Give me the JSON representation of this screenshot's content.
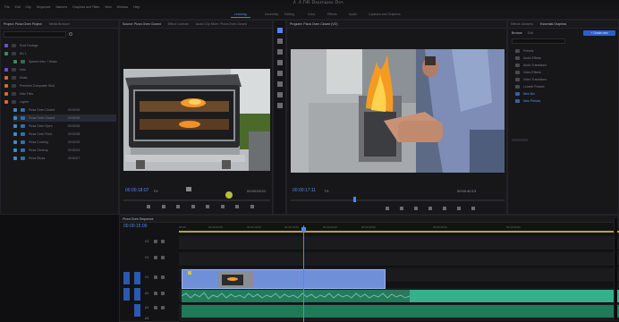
{
  "app": {
    "title": "人人DB Premiere Pro",
    "menu": [
      "File",
      "Edit",
      "Clip",
      "Sequence",
      "Markers",
      "Graphics and Titles",
      "View",
      "Window",
      "Help"
    ],
    "workspaces": [
      "Learning",
      "Assembly",
      "Editing",
      "Color",
      "Effects",
      "Audio",
      "Captions and Graphics"
    ],
    "active_workspace": "Learning"
  },
  "project_panel": {
    "tabs": [
      "Project: Pizza Oven Project",
      "Media Browser"
    ],
    "search_placeholder": "",
    "items": [
      {
        "name": "Root Footage",
        "color": "#6a4fd6"
      },
      {
        "name": "Bin 1",
        "color": "#2f8f5f"
      },
      {
        "name": "Speech Intro + Music",
        "color": "#2f8f5f"
      },
      {
        "name": "Intro",
        "color": "#6a4fd6"
      },
      {
        "name": "Music",
        "color": "#d96b2b"
      },
      {
        "name": "Premiere Composite Shot",
        "color": "#d96b2b"
      },
      {
        "name": "Misc Files",
        "color": "#d96b2b"
      },
      {
        "name": "Layers",
        "color": "#d96b2b"
      },
      {
        "name": "Pizza Oven Closed",
        "color": "#3a8ed0"
      },
      {
        "name": "Pizza Oven Closed",
        "color": "#3a8ed0"
      },
      {
        "name": "Pizza Oven Open",
        "color": "#3a8ed0"
      },
      {
        "name": "Pizza Oven Fired",
        "color": "#3a8ed0"
      },
      {
        "name": "Pizza Cooking",
        "color": "#3a8ed0"
      },
      {
        "name": "Pizza Closeup",
        "color": "#3a8ed0"
      },
      {
        "name": "Pizza Slices",
        "color": "#3a8ed0"
      }
    ],
    "durations": [
      "00:00:05",
      "00:00:05",
      "00:00:06",
      "00:00:08",
      "00:00:09",
      "00:00:04",
      "00:00:07"
    ]
  },
  "source_monitor": {
    "tabs": [
      "Source: Pizza Oven Closed",
      "Effect Controls",
      "Audio Clip Mixer: Pizza Oven Closed"
    ],
    "timecode_left": "00:00:18:07",
    "timecode_right": "00:00:03:21",
    "zoom": "Fit"
  },
  "program_monitor": {
    "tabs": [
      "Program: Pizza Oven Closed (VO)"
    ],
    "timecode_left": "00:00:17:11",
    "timecode_right": "00:00:40:13",
    "zoom": "Fit"
  },
  "effects_panel": {
    "tabs": [
      "Effects Libraries",
      "Essential Graphics"
    ],
    "subtabs": [
      "Browse",
      "Edit"
    ],
    "button": "+ Create new",
    "items": [
      "Presets",
      "Audio Effects",
      "Audio Transitions",
      "Video Effects",
      "Video Transitions",
      "Lumetri Presets",
      "New Bin",
      "New Presets"
    ]
  },
  "timeline": {
    "tab": "Pizza Oven Sequence",
    "timecode": "00:00:15:09",
    "ruler": [
      "00:00",
      "00:00:05:00",
      "00:00:10:00",
      "00:00:15:00",
      "00:00:20:00",
      "00:00:25:00",
      "00:00:30:00",
      "00:00:35:00"
    ],
    "tracks": [
      "V3",
      "V2",
      "V1",
      "A1",
      "A2",
      "A3"
    ]
  },
  "colors": {
    "accent": "#4f86f7",
    "clip_video": "#6f8fd9",
    "clip_audio": "#2f9a74"
  }
}
